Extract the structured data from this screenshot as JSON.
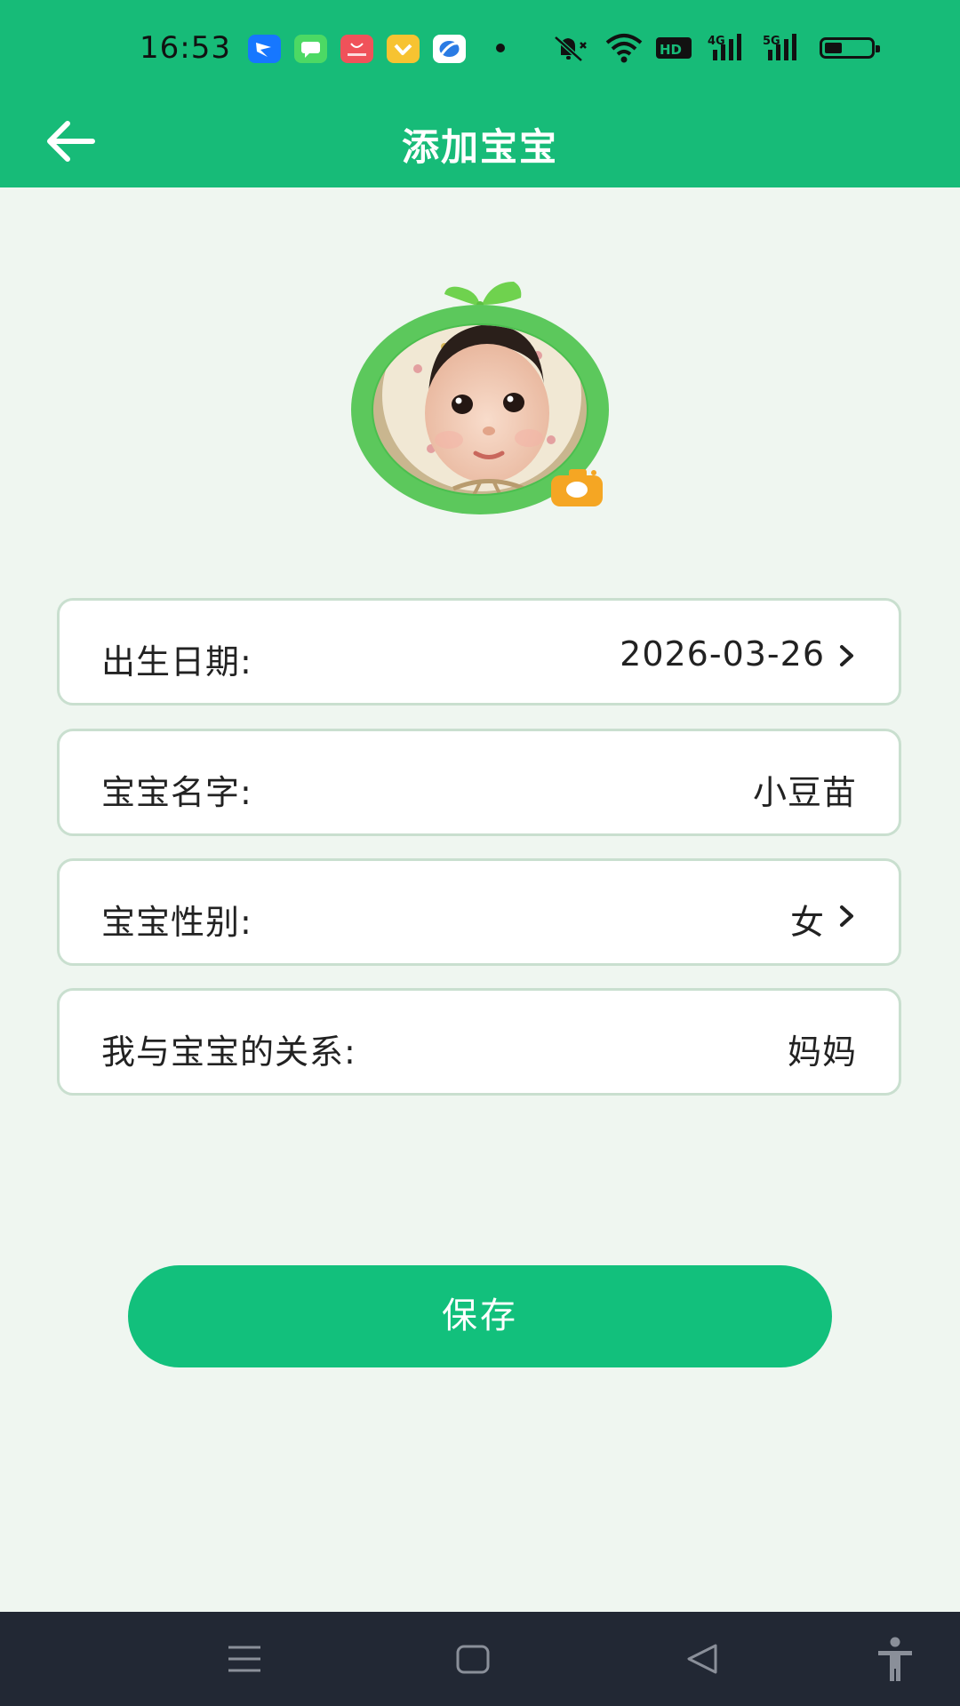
{
  "status_bar": {
    "time": "16:53",
    "notification_icons": [
      "lark-app-icon",
      "messages-app-icon",
      "huawei-appgallery-icon",
      "yellow-app-icon",
      "browser-app-icon"
    ],
    "system_icons": [
      "mute-bell-icon",
      "wifi-icon",
      "hd-icon",
      "4g-signal-icon",
      "5g-signal-icon",
      "battery-icon"
    ]
  },
  "header": {
    "title": "添加宝宝",
    "back_icon": "arrow-left-icon"
  },
  "avatar": {
    "image": "baby-photo-with-sprout-frame",
    "camera_icon": "camera-icon"
  },
  "form": {
    "rows": [
      {
        "label": "出生日期:",
        "value": "2026-03-26",
        "has_arrow": true
      },
      {
        "label": "宝宝名字:",
        "value": "小豆苗",
        "has_arrow": false
      },
      {
        "label": "宝宝性别:",
        "value": "女",
        "has_arrow": true
      },
      {
        "label": "我与宝宝的关系:",
        "value": "妈妈",
        "has_arrow": false
      }
    ]
  },
  "save_button": {
    "label": "保存"
  },
  "nav_bar": {
    "icons": [
      "menu-icon",
      "home-square-icon",
      "back-triangle-icon",
      "accessibility-icon"
    ]
  },
  "colors": {
    "header": "#17bb78",
    "background": "#eff6f0",
    "button": "#12c07c",
    "row_border": "#c9dfcf",
    "camera": "#f5a623",
    "navbar": "#222834"
  }
}
